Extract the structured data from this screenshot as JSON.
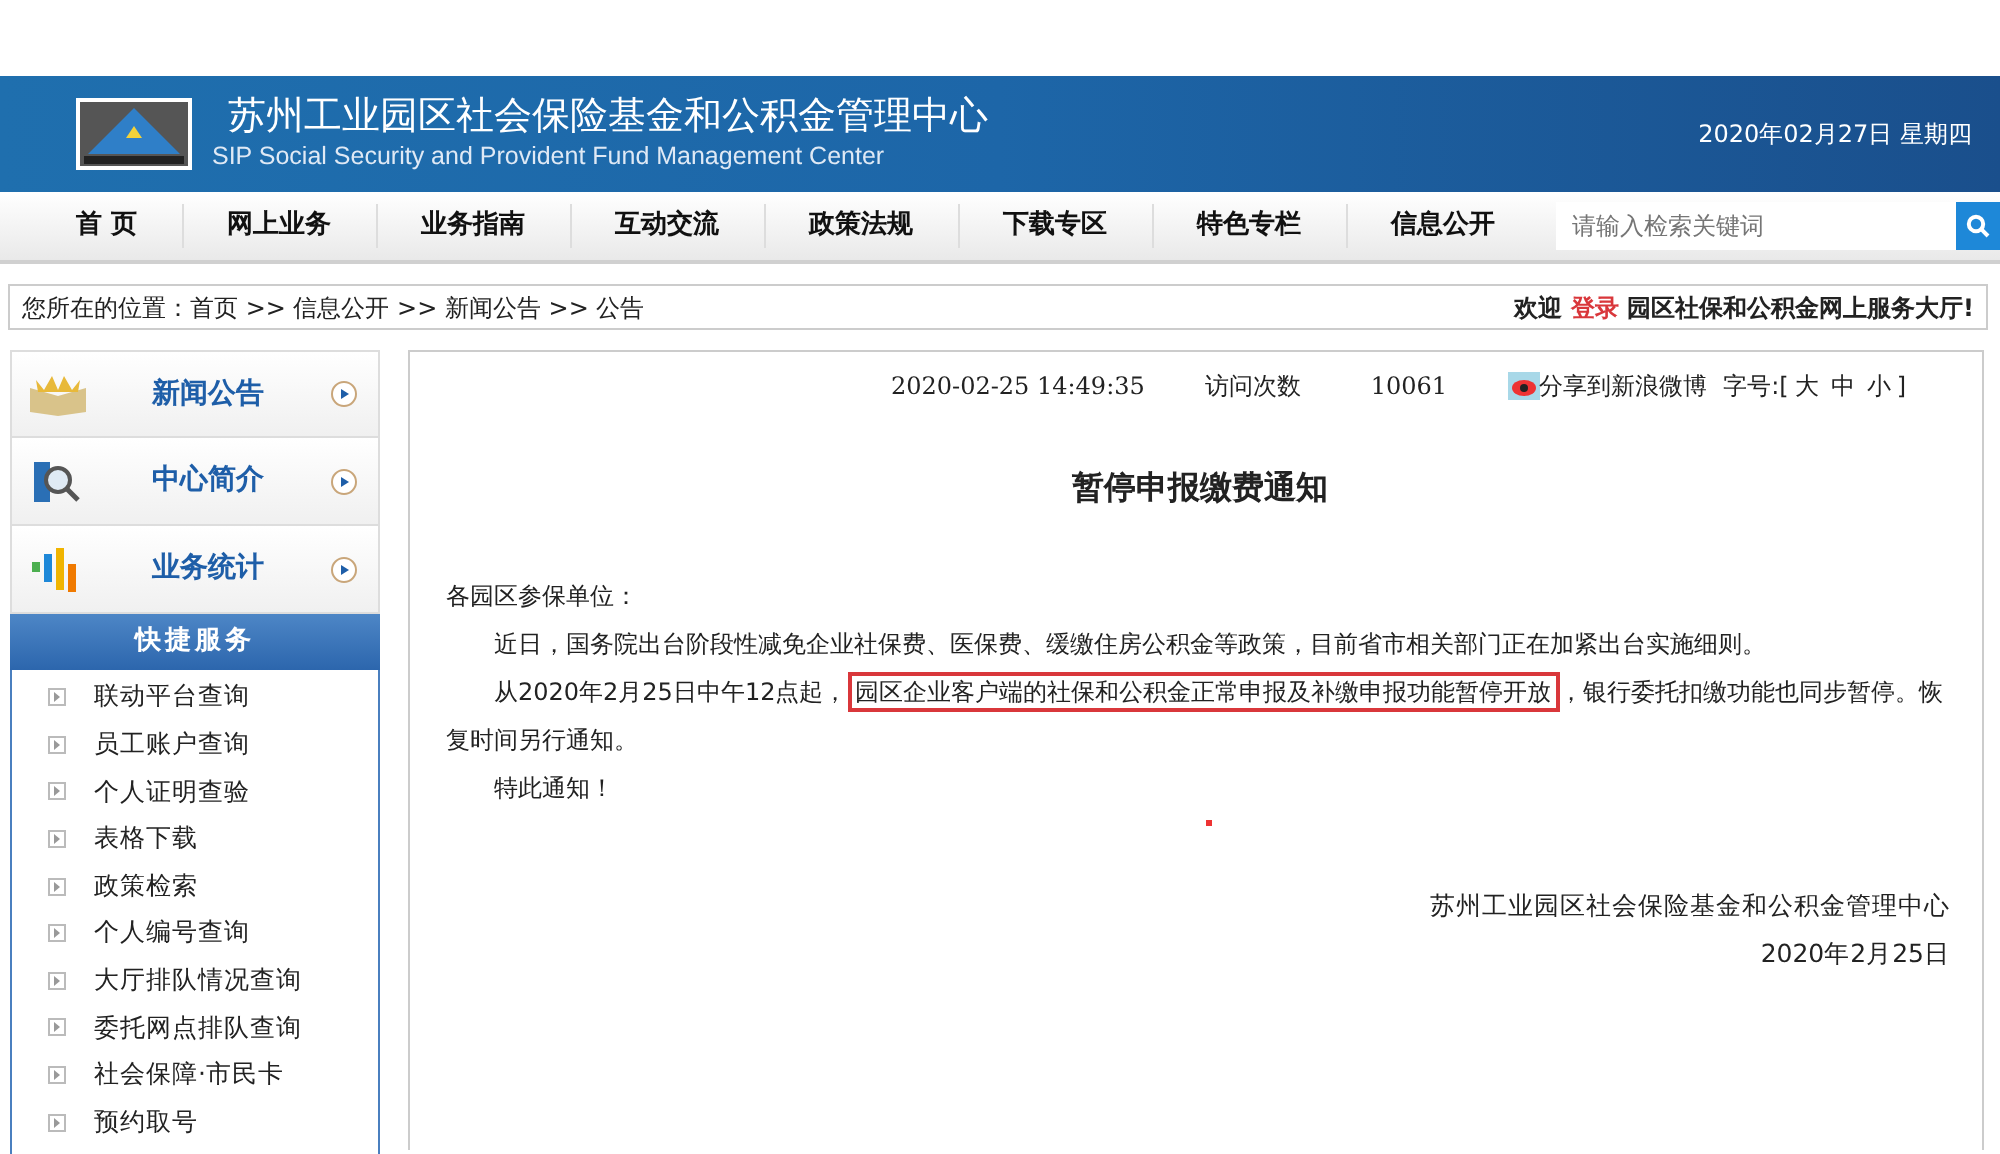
{
  "header": {
    "title": "苏州工业园区社会保险基金和公积金管理中心",
    "subtitle": "SIP Social Security and Provident Fund Management Center",
    "date": "2020年02月27日 星期四"
  },
  "nav": {
    "items": [
      "首 页",
      "网上业务",
      "业务指南",
      "互动交流",
      "政策法规",
      "下载专区",
      "特色专栏",
      "信息公开"
    ],
    "search": {
      "placeholder": "请输入检索关键词"
    }
  },
  "breadcrumb": {
    "label": "您所在的位置：",
    "items": [
      "首页",
      "信息公开",
      "新闻公告",
      "公告"
    ],
    "separator": ">>"
  },
  "welcome": {
    "before": "欢迎",
    "login": "登录",
    "after": "园区社保和公积金网上服务大厅!"
  },
  "sidebar": {
    "sections": [
      {
        "label": "新闻公告",
        "kind": "book"
      },
      {
        "label": "中心简介",
        "kind": "search"
      },
      {
        "label": "业务统计",
        "kind": "chart"
      }
    ],
    "quick_title": "快捷服务",
    "quick_items": [
      "联动平台查询",
      "员工账户查询",
      "个人证明查验",
      "表格下载",
      "政策检索",
      "个人编号查询",
      "大厅排队情况查询",
      "委托网点排队查询",
      "社会保障·市民卡",
      "预约取号"
    ]
  },
  "article": {
    "datetime": "2020-02-25 14:49:35",
    "visits_label": "访问次数",
    "visits": "10061",
    "share": "分享到新浪微博",
    "font_size_label": "字号:[",
    "font_size_close": "]",
    "font_sizes": [
      "大",
      "中",
      "小"
    ],
    "title": "暂停申报缴费通知",
    "greeting": "各园区参保单位：",
    "paragraphs": [
      {
        "before": "近日，国务院出台阶段性减免企业社保费、医保费、缓缴住房公积金等政策，目前省市相关部门正在加紧出台实施细则。"
      },
      {
        "before": "从2020年2月25日中午12点起，",
        "boxed": "园区企业客户端的社保和公积金正常申报及补缴申报功能暂停开放",
        "after": "，银行委托扣缴功能也同步暂停。恢复时间另行通知。"
      },
      {
        "before": "特此通知！"
      }
    ],
    "signature": "苏州工业园区社会保险基金和公积金管理中心",
    "sign_date": "2020年2月25日"
  }
}
